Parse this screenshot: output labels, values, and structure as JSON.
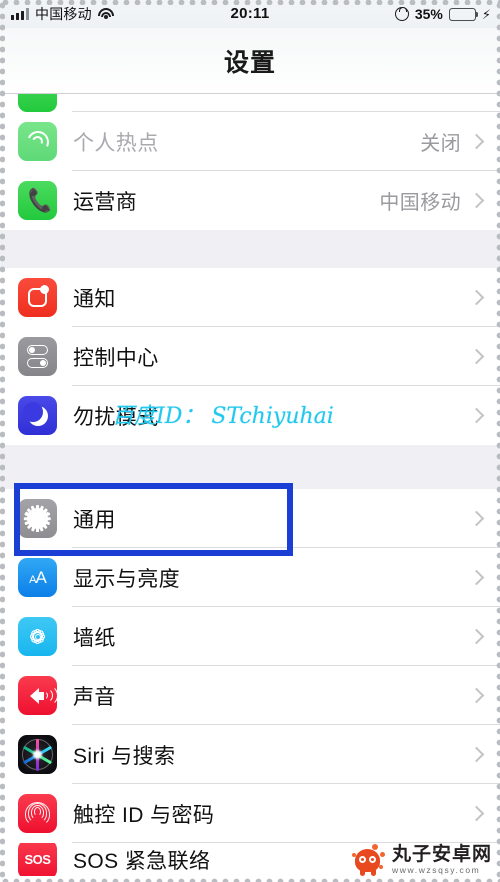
{
  "status_bar": {
    "signal_icon": "signal-bars-icon",
    "carrier": "中国移动",
    "wifi_icon": "wifi-icon",
    "time": "20:11",
    "rotation_lock_icon": "rotation-lock-icon",
    "battery_percent": "35%",
    "battery_fill": 35,
    "charging_icon": "charging-bolt-icon",
    "battery_color": "#3edb3e"
  },
  "nav": {
    "title": "设置"
  },
  "groups": [
    {
      "id": "group-connectivity",
      "rows": [
        {
          "id": "row-partial-top",
          "icon": "green-app-icon",
          "label": "",
          "value": "",
          "clipped": "top"
        },
        {
          "id": "row-personal-hotspot",
          "icon": "hotspot-icon",
          "label": "个人热点",
          "value": "关闭",
          "dim": true
        },
        {
          "id": "row-carrier",
          "icon": "phone-icon",
          "label": "运营商",
          "value": "中国移动"
        }
      ]
    },
    {
      "id": "group-notifications",
      "rows": [
        {
          "id": "row-notifications",
          "icon": "notifications-icon",
          "label": "通知",
          "value": ""
        },
        {
          "id": "row-control-center",
          "icon": "control-center-icon",
          "label": "控制中心",
          "value": ""
        },
        {
          "id": "row-do-not-disturb",
          "icon": "moon-icon",
          "label": "勿扰模式",
          "value": ""
        }
      ]
    },
    {
      "id": "group-general",
      "rows": [
        {
          "id": "row-general",
          "icon": "gear-icon",
          "label": "通用",
          "value": "",
          "highlighted": true
        },
        {
          "id": "row-display-brightness",
          "icon": "display-icon",
          "label": "显示与亮度",
          "value": ""
        },
        {
          "id": "row-wallpaper",
          "icon": "wallpaper-icon",
          "label": "墙纸",
          "value": ""
        },
        {
          "id": "row-sounds",
          "icon": "speaker-icon",
          "label": "声音",
          "value": ""
        },
        {
          "id": "row-siri-search",
          "icon": "siri-icon",
          "label": "Siri 与搜索",
          "value": ""
        },
        {
          "id": "row-touch-id-passcode",
          "icon": "fingerprint-icon",
          "label": "触控 ID 与密码",
          "value": ""
        },
        {
          "id": "row-sos",
          "icon": "sos-icon",
          "label": "SOS 紧急联络",
          "value": "",
          "clipped": "bottom"
        }
      ]
    }
  ],
  "annotation": {
    "target": "通用",
    "color": "#1b3fd4"
  },
  "watermarks": {
    "text": "百度ID： STchiyuhai",
    "text_color": "#22c8ee",
    "logo_name": "丸子安卓网",
    "logo_url": "www.wzsqsy.com",
    "logo_color": "#e8491f"
  }
}
